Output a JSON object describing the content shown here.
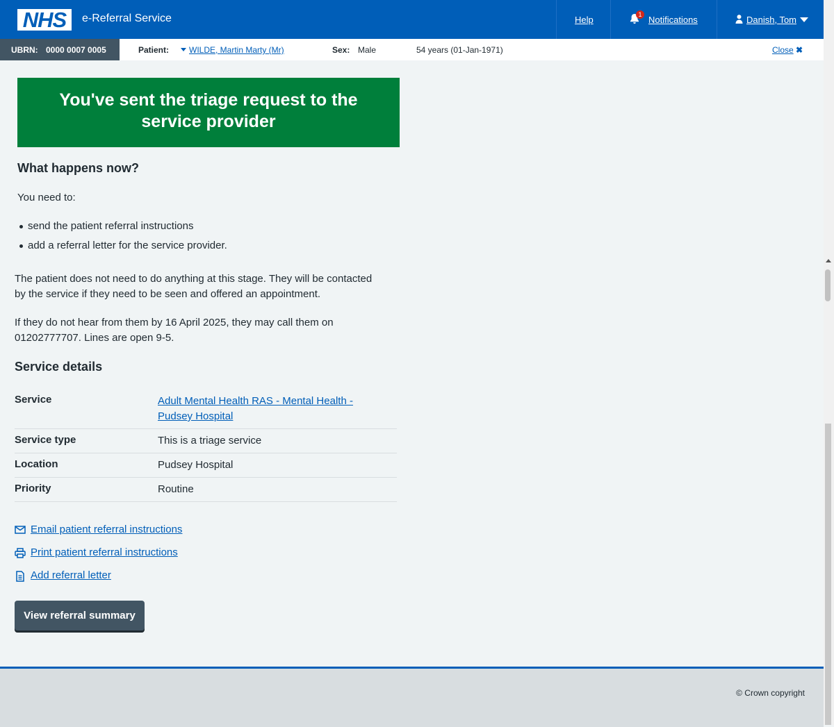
{
  "header": {
    "logo_text": "NHS",
    "service_name": "e-Referral Service",
    "help": "Help",
    "notifications": "Notifications",
    "notification_count": "1",
    "user": "Danish, Tom",
    "brand_color": "#005eb8"
  },
  "banner": {
    "ubrn_label": "UBRN:",
    "ubrn_value": "0000 0007 0005",
    "patient_label": "Patient:",
    "patient_name": "WILDE, Martin Marty (Mr)",
    "sex_label": "Sex:",
    "sex_value": "Male",
    "age_dob": "54 years (01-Jan-1971)",
    "close": "Close"
  },
  "panel": {
    "title_line1": "You've sent the triage request to the",
    "title_line2": "service provider",
    "color": "#007f3b"
  },
  "what_happens": {
    "heading": "What happens now?",
    "intro": "You need to:",
    "items": [
      "send the patient referral instructions",
      "add a referral letter for the service provider."
    ],
    "para1_line1": "The patient does not need to do anything at this stage. They will be contacted",
    "para1_line2": "by the service if they need to be seen and offered an appointment.",
    "para2_line1": "If they do not hear from them by 16 April 2025, they may call them on",
    "para2_line2": "01202777707. Lines are open 9-5."
  },
  "service_details": {
    "heading": "Service details",
    "rows": [
      {
        "key": "Service",
        "value_line1": "Adult Mental Health RAS - Mental Health -",
        "value_line2": "Pudsey Hospital"
      },
      {
        "key": "Service type",
        "value": "This is a triage service"
      },
      {
        "key": "Location",
        "value": "Pudsey Hospital"
      },
      {
        "key": "Priority",
        "value": "Routine"
      }
    ]
  },
  "actions": {
    "email": "Email patient referral instructions",
    "print": "Print patient referral instructions",
    "letter": "Add referral letter",
    "view_summary": "View referral summary"
  },
  "footer": {
    "copyright": "© Crown copyright"
  }
}
